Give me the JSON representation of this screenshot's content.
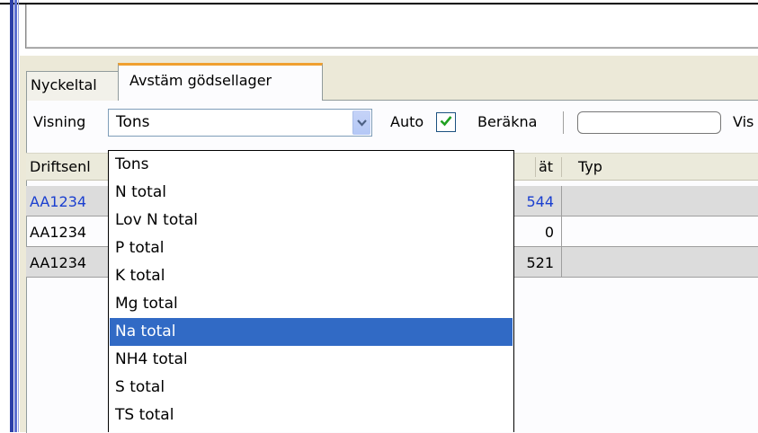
{
  "tabs": [
    "Nyckeltal",
    "Avstäm gödsellager"
  ],
  "toolbar": {
    "visning_label": "Visning",
    "selected_value": "Tons",
    "auto_label": "Auto",
    "auto_checked": true,
    "berakna_label": "Beräkna",
    "vis_label": "Vis"
  },
  "grid": {
    "headers": [
      "Driftsenl",
      "ät",
      "Typ"
    ],
    "rows": [
      {
        "id": "AA1234",
        "value": "544"
      },
      {
        "id": "AA1234",
        "value": "0"
      },
      {
        "id": "AA1234",
        "value": "521"
      }
    ]
  },
  "dropdown": {
    "options": [
      "Tons",
      "N total",
      "Lov N total",
      "P total",
      "K total",
      "Mg total",
      "Na total",
      "NH4 total",
      "S total",
      "TS total"
    ],
    "highlighted": "Na total"
  },
  "colors": {
    "accent_tab": "#f0a030",
    "selection": "#316ac5",
    "link": "#1a3fd0",
    "check": "#21a121"
  },
  "icons": {
    "combo_arrow": "chevron-down-icon",
    "check": "checkmark-icon"
  }
}
